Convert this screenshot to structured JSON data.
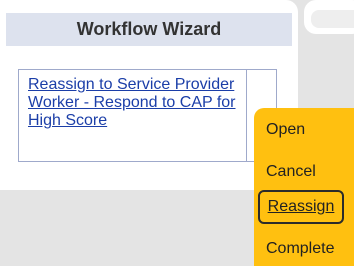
{
  "dialog": {
    "title": "Workflow Wizard",
    "task_link": "Reassign to Service Provider Worker - Respond to CAP for High Score"
  },
  "menu": {
    "items": [
      "Open",
      "Cancel",
      "Reassign",
      "Complete"
    ],
    "selected": "Reassign",
    "background": "#ffc010"
  }
}
